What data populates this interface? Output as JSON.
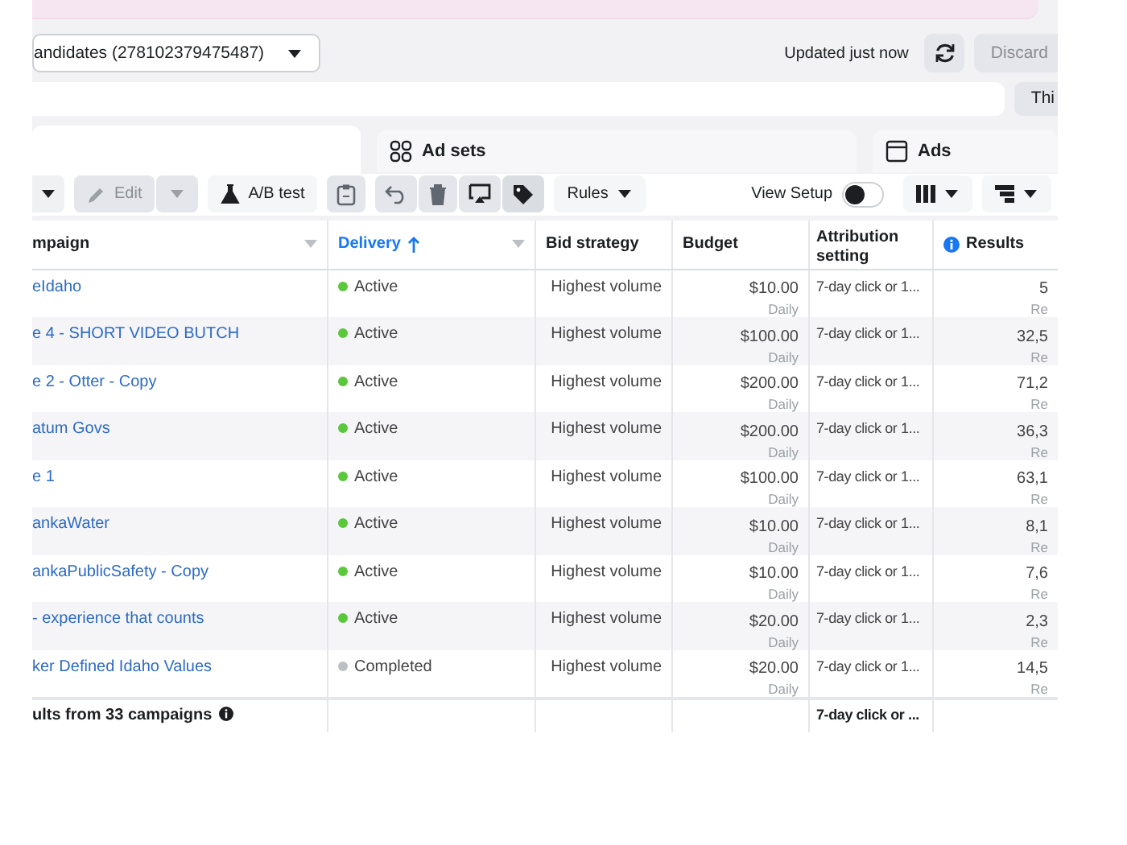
{
  "account_selector": {
    "label": "andidates (278102379475487)"
  },
  "update_status": "Updated just now",
  "header_buttons": [
    {
      "kind": "refresh"
    },
    {
      "kind": "text",
      "label": "Discard"
    }
  ],
  "filter_bar": {
    "button": "Thi"
  },
  "tabs": [
    {
      "kind": "campaigns",
      "selected": true
    },
    {
      "kind": "adsets",
      "label": "Ad sets",
      "selected": false
    },
    {
      "kind": "ads",
      "label": "Ads",
      "selected": false
    }
  ],
  "toolbar": {
    "edit": "Edit",
    "ab_test": "A/B test",
    "rules": "Rules",
    "view_setup": "View Setup",
    "view_setup_on": false
  },
  "table": {
    "columns": [
      {
        "kind": "filter",
        "label": "mpaign",
        "sorted": false
      },
      {
        "kind": "filter",
        "label": "Delivery",
        "sorted": true
      },
      {
        "kind": "plain",
        "label": "Bid strategy",
        "sorted": false
      },
      {
        "kind": "plain",
        "label": "Budget",
        "sorted": false
      },
      {
        "kind": "plain",
        "label": "Attribution setting",
        "sorted": false
      },
      {
        "kind": "metric",
        "label": "Results",
        "sorted": false
      }
    ],
    "rows": [
      {
        "campaign": "eIdaho",
        "delivery": "Active",
        "color": "#5ac83a",
        "bid": "Highest volume",
        "budget": "$10.00",
        "period": "Daily",
        "attribution": "7-day click or 1...",
        "results": "5",
        "results_sub": "Re"
      },
      {
        "campaign": "e 4 - SHORT VIDEO BUTCH",
        "delivery": "Active",
        "color": "#5ac83a",
        "bid": "Highest volume",
        "budget": "$100.00",
        "period": "Daily",
        "attribution": "7-day click or 1...",
        "results": "32,5",
        "results_sub": "Re"
      },
      {
        "campaign": "e 2 - Otter - Copy",
        "delivery": "Active",
        "color": "#5ac83a",
        "bid": "Highest volume",
        "budget": "$200.00",
        "period": "Daily",
        "attribution": "7-day click or 1...",
        "results": "71,2",
        "results_sub": "Re"
      },
      {
        "campaign": "atum Govs",
        "delivery": "Active",
        "color": "#5ac83a",
        "bid": "Highest volume",
        "budget": "$200.00",
        "period": "Daily",
        "attribution": "7-day click or 1...",
        "results": "36,3",
        "results_sub": "Re"
      },
      {
        "campaign": "e 1",
        "delivery": "Active",
        "color": "#5ac83a",
        "bid": "Highest volume",
        "budget": "$100.00",
        "period": "Daily",
        "attribution": "7-day click or 1...",
        "results": "63,1",
        "results_sub": "Re"
      },
      {
        "campaign": "ankaWater",
        "delivery": "Active",
        "color": "#5ac83a",
        "bid": "Highest volume",
        "budget": "$10.00",
        "period": "Daily",
        "attribution": "7-day click or 1...",
        "results": "8,1",
        "results_sub": "Re"
      },
      {
        "campaign": "ankaPublicSafety - Copy",
        "delivery": "Active",
        "color": "#5ac83a",
        "bid": "Highest volume",
        "budget": "$10.00",
        "period": "Daily",
        "attribution": "7-day click or 1...",
        "results": "7,6",
        "results_sub": "Re"
      },
      {
        "campaign": "- experience that counts",
        "delivery": "Active",
        "color": "#5ac83a",
        "bid": "Highest volume",
        "budget": "$20.00",
        "period": "Daily",
        "attribution": "7-day click or 1...",
        "results": "2,3",
        "results_sub": "Re"
      },
      {
        "campaign": "ker Defined Idaho Values",
        "delivery": "Completed",
        "color": "#bcc0c4",
        "bid": "Highest volume",
        "budget": "$20.00",
        "period": "Daily",
        "attribution": "7-day click or 1...",
        "results": "14,5",
        "results_sub": "Re"
      }
    ],
    "footer": {
      "summary": "ults from 33 campaigns",
      "attribution": "7-day click or ..."
    }
  }
}
